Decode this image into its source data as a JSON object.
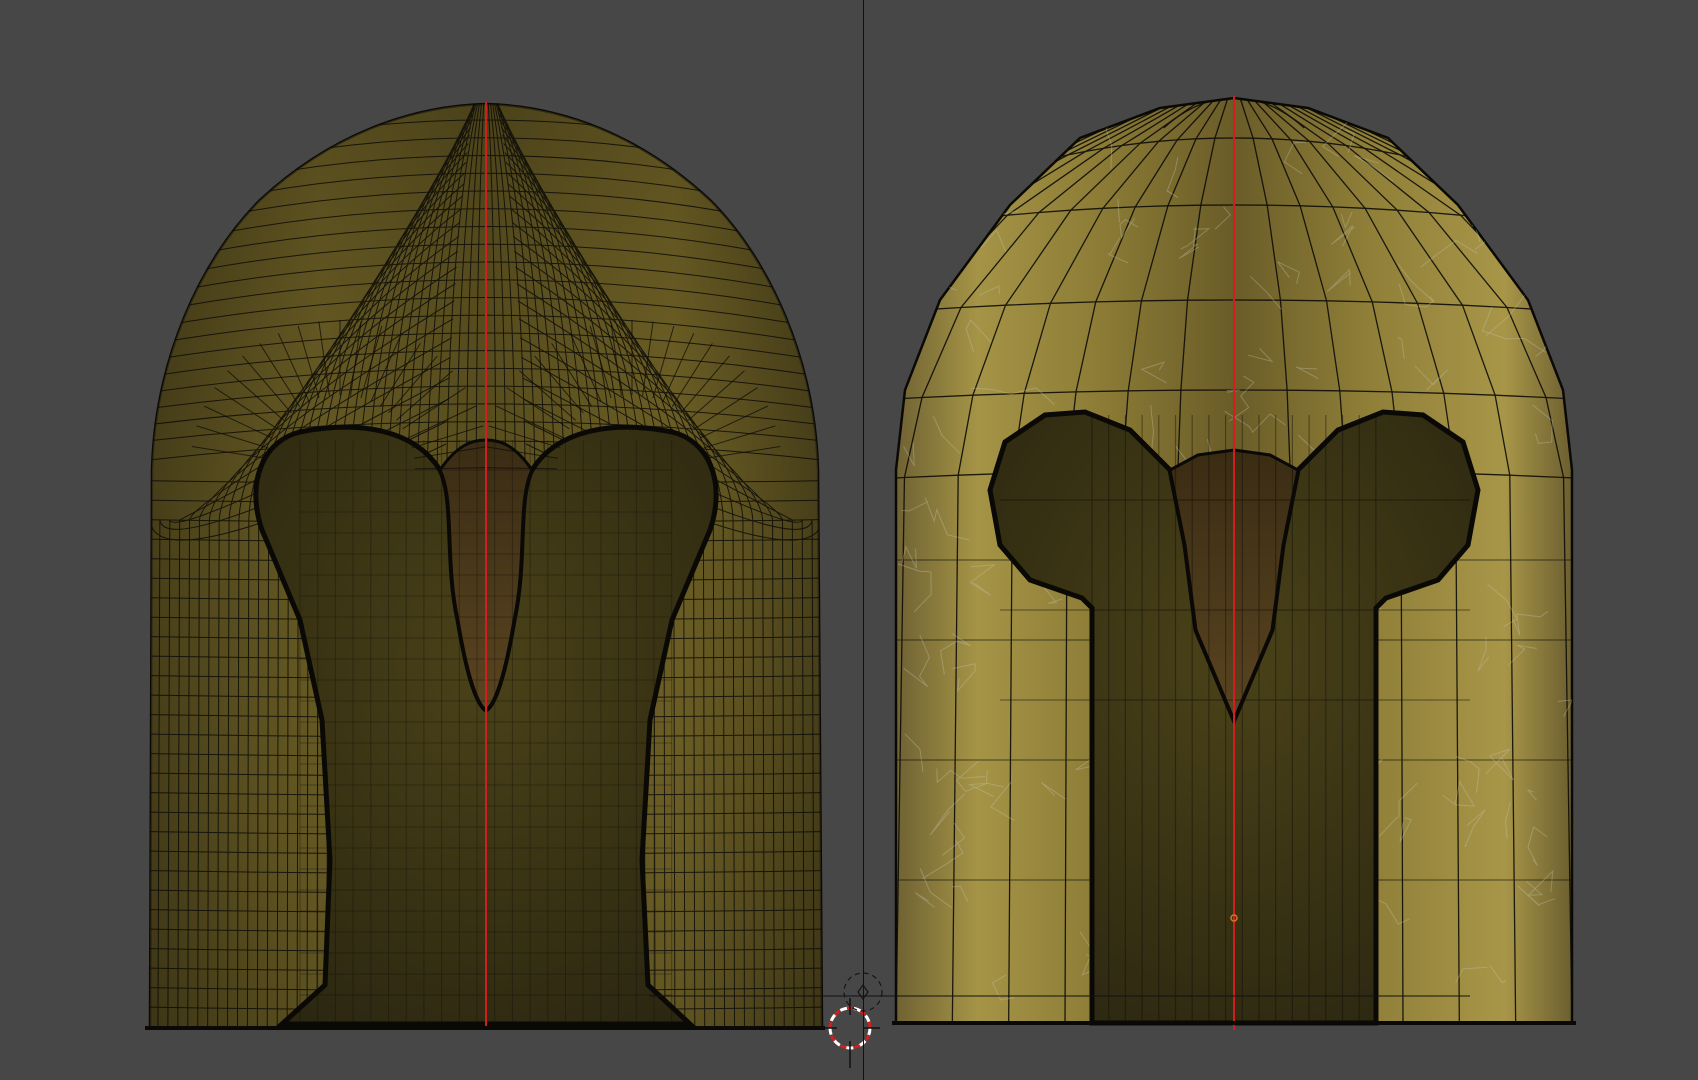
{
  "viewport": {
    "background": "#474747",
    "panes": [
      {
        "name": "high-poly-helmet",
        "shading": "textured-wireframe"
      },
      {
        "name": "low-poly-helmet",
        "shading": "textured-wireframe"
      }
    ],
    "mirror_axis_color": "#d21e1e",
    "wire_color": "#0d0c08",
    "icons": [
      "3d-cursor-icon",
      "origin-icon"
    ]
  },
  "materials": {
    "bronze_dark": "#4a4218",
    "bronze_mid": "#7a6b2a",
    "bronze_light": "#a99745",
    "bronze_shadow": "#2a2410"
  }
}
